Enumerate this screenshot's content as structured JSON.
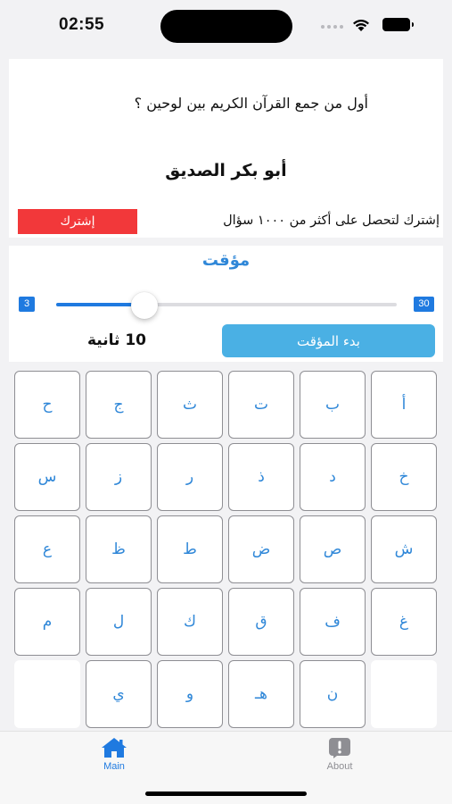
{
  "status_bar": {
    "time": "02:55"
  },
  "question": {
    "text": "أول من جمع القرآن الكريم بين لوحين ؟",
    "answer": "أبو بكر الصديق"
  },
  "promo": {
    "text": "إشترك لتحصل على أكثر من ١٠٠٠ سؤال",
    "button_label": "إشترك",
    "button_color": "#f2383a"
  },
  "timer": {
    "title": "مؤقت",
    "min_label": "3",
    "max_label": "30",
    "min": 3,
    "max": 30,
    "value": 10,
    "seconds_label": "10 ثانية",
    "start_label": "بدء المؤقت",
    "accent": "#1f7ae0"
  },
  "keyboard": {
    "rows": [
      [
        "أ",
        "ب",
        "ت",
        "ث",
        "ج",
        "ح"
      ],
      [
        "خ",
        "د",
        "ذ",
        "ر",
        "ز",
        "س"
      ],
      [
        "ش",
        "ص",
        "ض",
        "ط",
        "ظ",
        "ع"
      ],
      [
        "غ",
        "ف",
        "ق",
        "ك",
        "ل",
        "م"
      ],
      [
        "",
        "ن",
        "هـ",
        "و",
        "ي",
        ""
      ]
    ]
  },
  "tabs": [
    {
      "label": "Main",
      "icon": "house-icon",
      "active": true
    },
    {
      "label": "About",
      "icon": "exclamation-icon",
      "active": false
    }
  ]
}
